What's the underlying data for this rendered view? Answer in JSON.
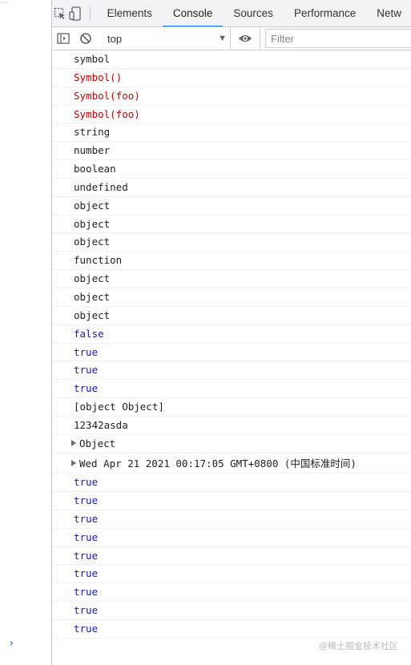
{
  "tabs": [
    "Elements",
    "Console",
    "Sources",
    "Performance",
    "Netw"
  ],
  "active_tab": "Console",
  "toolbar": {
    "context": "top",
    "context_arrow": "▼",
    "filter_placeholder": "Filter"
  },
  "console_rows": [
    {
      "text": "symbol",
      "type": "string"
    },
    {
      "text": "Symbol()",
      "type": "symbol"
    },
    {
      "text": "Symbol(foo)",
      "type": "symbol"
    },
    {
      "text": "Symbol(foo)",
      "type": "symbol"
    },
    {
      "text": "string",
      "type": "string"
    },
    {
      "text": "number",
      "type": "string"
    },
    {
      "text": "boolean",
      "type": "string"
    },
    {
      "text": "undefined",
      "type": "string"
    },
    {
      "text": "object",
      "type": "string"
    },
    {
      "text": "object",
      "type": "string"
    },
    {
      "text": "object",
      "type": "string"
    },
    {
      "text": "function",
      "type": "string"
    },
    {
      "text": "object",
      "type": "string"
    },
    {
      "text": "object",
      "type": "string"
    },
    {
      "text": "object",
      "type": "string"
    },
    {
      "text": "false",
      "type": "boolean"
    },
    {
      "text": "true",
      "type": "boolean"
    },
    {
      "text": "true",
      "type": "boolean"
    },
    {
      "text": "true",
      "type": "boolean"
    },
    {
      "text": "[object Object]",
      "type": "string"
    },
    {
      "text": "12342asda",
      "type": "string"
    },
    {
      "text": "Object",
      "type": "expandable"
    },
    {
      "text": "Wed Apr 21 2021 00:17:05 GMT+0800 (中国标准时间)",
      "type": "expandable",
      "tall": true
    },
    {
      "text": "true",
      "type": "boolean"
    },
    {
      "text": "true",
      "type": "boolean"
    },
    {
      "text": "true",
      "type": "boolean"
    },
    {
      "text": "true",
      "type": "boolean"
    },
    {
      "text": "true",
      "type": "boolean"
    },
    {
      "text": "true",
      "type": "boolean"
    },
    {
      "text": "true",
      "type": "boolean"
    },
    {
      "text": "true",
      "type": "boolean"
    },
    {
      "text": "true",
      "type": "boolean"
    }
  ],
  "prompt_symbol": "›",
  "watermark": "@稀土掘金技术社区",
  "colors": {
    "symbol": "#c80000",
    "boolean": "#1a1aa6",
    "accent": "#1a73e8"
  }
}
